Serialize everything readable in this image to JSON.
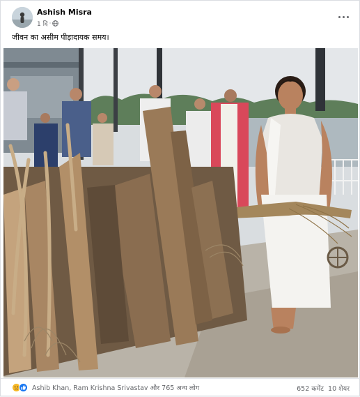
{
  "post": {
    "author": "Ashish Misra",
    "time": "1 दि",
    "separator": "·",
    "privacy_icon": "globe-icon",
    "more_icon": "more-options-icon",
    "text": "जीवन का असीम पीड़ादायक समय।"
  },
  "photo": {
    "subject": "cremation-pyre-scene"
  },
  "footer": {
    "reaction_icons": [
      "sad-reaction-icon",
      "like-reaction-icon"
    ],
    "reactors": "Ashib Khan, Ram Krishna Srivastav और 765 अन्य लोग",
    "comments": "652 कमेंट",
    "shares": "10 शेयर"
  },
  "colors": {
    "card_bg": "#ffffff",
    "secondary_text": "#65676b",
    "like_blue": "#1877f2",
    "sad_yellow": "#f7b928"
  }
}
